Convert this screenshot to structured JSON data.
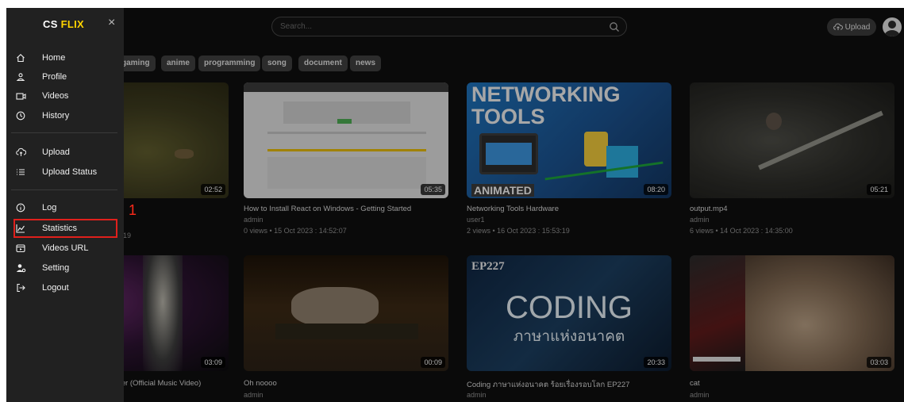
{
  "header": {
    "search_placeholder": "Search...",
    "upload_label": "Upload"
  },
  "sidebar": {
    "brand_prefix": "CS",
    "brand_accent": "FLIX",
    "close": "×",
    "items": [
      {
        "label": "Home",
        "icon": "home-icon"
      },
      {
        "label": "Profile",
        "icon": "profile-icon"
      },
      {
        "label": "Videos",
        "icon": "videos-icon"
      },
      {
        "label": "History",
        "icon": "history-icon"
      },
      {
        "label": "Upload",
        "icon": "upload-icon"
      },
      {
        "label": "Upload Status",
        "icon": "list-icon"
      },
      {
        "label": "Log",
        "icon": "info-icon"
      },
      {
        "label": "Statistics",
        "icon": "statistics-icon"
      },
      {
        "label": "Videos URL",
        "icon": "video-url-icon"
      },
      {
        "label": "Setting",
        "icon": "settings-icon"
      },
      {
        "label": "Logout",
        "icon": "logout-icon"
      }
    ]
  },
  "annotation": {
    "number": "1",
    "color": "#e0201c"
  },
  "chips": [
    "gaming",
    "anime",
    "programming",
    "song",
    "document",
    "news"
  ],
  "videos": [
    {
      "title": "",
      "author": "",
      "stats": "19",
      "duration": "02:52"
    },
    {
      "title": "How to Install React on Windows - Getting Started",
      "author": "admin",
      "stats": "0 views • 15 Oct 2023 : 14:52:07",
      "duration": "05:35"
    },
    {
      "title": "Networking Tools Hardware",
      "author": "user1",
      "stats": "2 views • 16 Oct 2023 : 15:53:19",
      "duration": "08:20",
      "thumb_text": [
        "NETWORKING",
        "TOOLS",
        "ANIMATED"
      ]
    },
    {
      "title": "output.mp4",
      "author": "admin",
      "stats": "6 views • 14 Oct 2023 : 14:35:00",
      "duration": "05:21"
    },
    {
      "title": "ver (Official Music Video)",
      "author": "",
      "stats": "",
      "duration": "03:09"
    },
    {
      "title": "Oh noooo",
      "author": "admin",
      "stats": "",
      "duration": "00:09"
    },
    {
      "title": "Coding ภาษาแห่งอนาคต ร้อยเรื่องรอบโลก EP227",
      "author": "admin",
      "stats": "",
      "duration": "20:33",
      "thumb_text": [
        "EP227",
        "CODING",
        "ภาษาแห่งอนาคต"
      ]
    },
    {
      "title": "cat",
      "author": "admin",
      "stats": "",
      "duration": "03:03"
    }
  ],
  "colors": {
    "accent": "#ffd400",
    "sidebar_bg": "#212121",
    "page_bg": "#0f0f0f",
    "highlight": "#e0201c"
  }
}
